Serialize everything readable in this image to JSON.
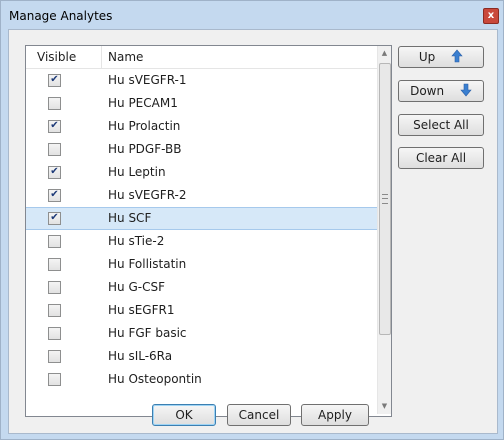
{
  "window": {
    "title": "Manage Analytes",
    "close_glyph": "x"
  },
  "list": {
    "columns": {
      "visible": "Visible",
      "name": "Name"
    },
    "rows": [
      {
        "name": "Hu sVEGFR-1",
        "checked": true,
        "selected": false
      },
      {
        "name": "Hu PECAM1",
        "checked": false,
        "selected": false
      },
      {
        "name": "Hu Prolactin",
        "checked": true,
        "selected": false
      },
      {
        "name": "Hu PDGF-BB",
        "checked": false,
        "selected": false
      },
      {
        "name": "Hu Leptin",
        "checked": true,
        "selected": false
      },
      {
        "name": "Hu sVEGFR-2",
        "checked": true,
        "selected": false
      },
      {
        "name": "Hu SCF",
        "checked": true,
        "selected": true
      },
      {
        "name": "Hu sTie-2",
        "checked": false,
        "selected": false
      },
      {
        "name": "Hu Follistatin",
        "checked": false,
        "selected": false
      },
      {
        "name": "Hu G-CSF",
        "checked": false,
        "selected": false
      },
      {
        "name": "Hu sEGFR1",
        "checked": false,
        "selected": false
      },
      {
        "name": "Hu FGF basic",
        "checked": false,
        "selected": false
      },
      {
        "name": "Hu sIL-6Ra",
        "checked": false,
        "selected": false
      },
      {
        "name": "Hu Osteopontin",
        "checked": false,
        "selected": false
      }
    ]
  },
  "side_buttons": {
    "up": "Up",
    "down": "Down",
    "select_all": "Select All",
    "clear_all": "Clear All"
  },
  "footer_buttons": {
    "ok": "OK",
    "cancel": "Cancel",
    "apply": "Apply"
  },
  "icons": {
    "up": "arrow-up-icon",
    "down": "arrow-down-icon",
    "check": "checkmark-icon"
  },
  "colors": {
    "accent_arrow": "#3a7fd0",
    "selection": "#d6e8f8",
    "title_bar": "#c4d9ef"
  }
}
